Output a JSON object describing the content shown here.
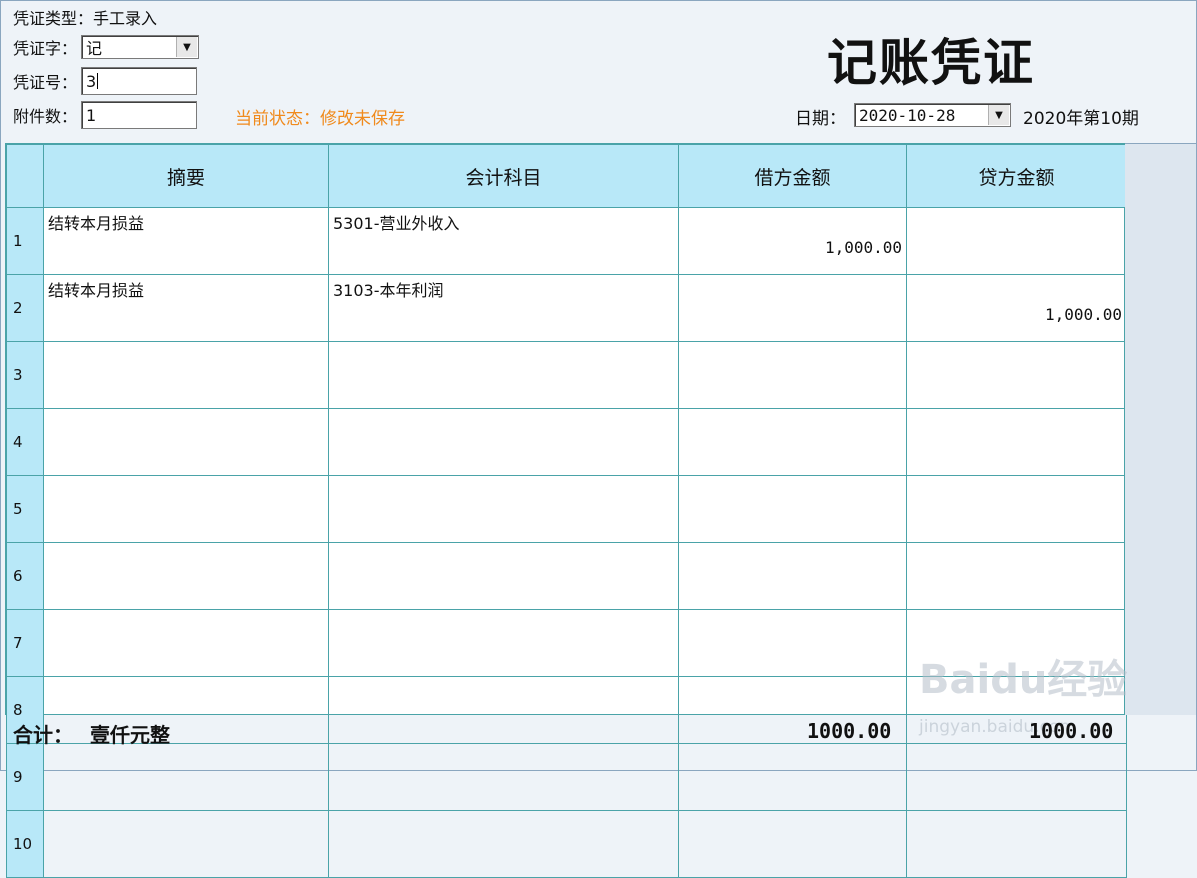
{
  "header": {
    "voucher_type_label": "凭证类型：",
    "voucher_type_value": "手工录入",
    "voucher_word_label": "凭证字：",
    "voucher_word_value": "记",
    "voucher_no_label": "凭证号：",
    "voucher_no_value": "3",
    "attachments_label": "附件数：",
    "attachments_value": "1",
    "status_text": "当前状态：修改未保存",
    "title": "记账凭证",
    "date_label": "日期：",
    "date_value": "2020-10-28",
    "period_text": "2020年第10期"
  },
  "table": {
    "columns": [
      "摘要",
      "会计科目",
      "借方金额",
      "贷方金额"
    ],
    "rows": [
      {
        "num": "1",
        "summary": "结转本月损益",
        "account": "5301-营业外收入",
        "debit": "1,000.00",
        "credit": ""
      },
      {
        "num": "2",
        "summary": "结转本月损益",
        "account": "3103-本年利润",
        "debit": "",
        "credit": "1,000.00"
      },
      {
        "num": "3",
        "summary": "",
        "account": "",
        "debit": "",
        "credit": ""
      },
      {
        "num": "4",
        "summary": "",
        "account": "",
        "debit": "",
        "credit": ""
      },
      {
        "num": "5",
        "summary": "",
        "account": "",
        "debit": "",
        "credit": ""
      },
      {
        "num": "6",
        "summary": "",
        "account": "",
        "debit": "",
        "credit": ""
      },
      {
        "num": "7",
        "summary": "",
        "account": "",
        "debit": "",
        "credit": ""
      },
      {
        "num": "8",
        "summary": "",
        "account": "",
        "debit": "",
        "credit": ""
      },
      {
        "num": "9",
        "summary": "",
        "account": "",
        "debit": "",
        "credit": ""
      },
      {
        "num": "10",
        "summary": "",
        "account": "",
        "debit": "",
        "credit": ""
      }
    ]
  },
  "footer": {
    "total_label": "合计：",
    "total_words": "壹仟元整",
    "debit_total": "1000.00",
    "credit_total": "1000.00"
  },
  "watermark": {
    "logo": "Baidu经验",
    "site": "jingyan.baidu.com"
  },
  "icons": {
    "dropdown": "chevron-down-icon"
  }
}
